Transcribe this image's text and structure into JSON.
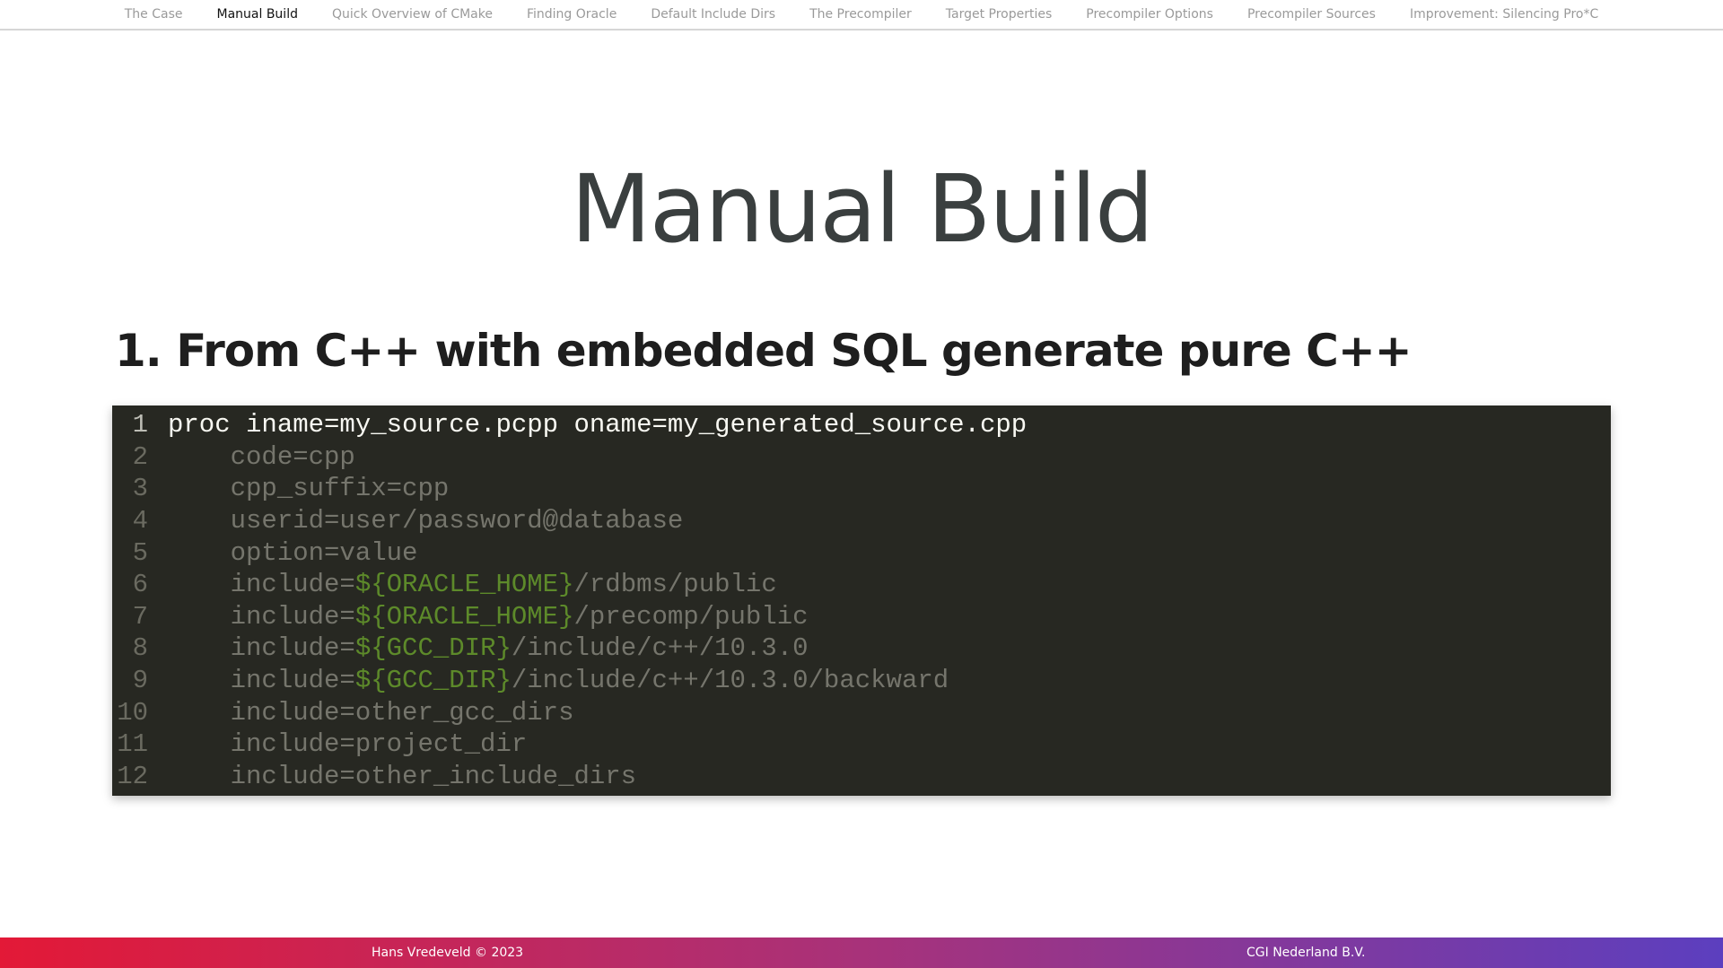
{
  "nav": {
    "items": [
      {
        "label": "The Case",
        "active": false
      },
      {
        "label": "Manual Build",
        "active": true
      },
      {
        "label": "Quick Overview of CMake",
        "active": false
      },
      {
        "label": "Finding Oracle",
        "active": false
      },
      {
        "label": "Default Include Dirs",
        "active": false
      },
      {
        "label": "The Precompiler",
        "active": false
      },
      {
        "label": "Target Properties",
        "active": false
      },
      {
        "label": "Precompiler Options",
        "active": false
      },
      {
        "label": "Precompiler Sources",
        "active": false
      },
      {
        "label": "Improvement: Silencing Pro*C",
        "active": false
      }
    ]
  },
  "slide": {
    "title": "Manual Build",
    "subheading": "1. From C++ with embedded SQL generate pure C++"
  },
  "code": {
    "lines": [
      {
        "no": "1",
        "highlight": true,
        "parts": [
          {
            "t": "proc iname=my_source.pcpp oname=my_generated_source.cpp"
          }
        ]
      },
      {
        "no": "2",
        "highlight": false,
        "parts": [
          {
            "t": "    code=cpp"
          }
        ]
      },
      {
        "no": "3",
        "highlight": false,
        "parts": [
          {
            "t": "    cpp_suffix=cpp"
          }
        ]
      },
      {
        "no": "4",
        "highlight": false,
        "parts": [
          {
            "t": "    userid=user/password@database"
          }
        ]
      },
      {
        "no": "5",
        "highlight": false,
        "parts": [
          {
            "t": "    option=value"
          }
        ]
      },
      {
        "no": "6",
        "highlight": false,
        "parts": [
          {
            "t": "    include="
          },
          {
            "t": "${ORACLE_HOME}",
            "var": true
          },
          {
            "t": "/rdbms/public"
          }
        ]
      },
      {
        "no": "7",
        "highlight": false,
        "parts": [
          {
            "t": "    include="
          },
          {
            "t": "${ORACLE_HOME}",
            "var": true
          },
          {
            "t": "/precomp/public"
          }
        ]
      },
      {
        "no": "8",
        "highlight": false,
        "parts": [
          {
            "t": "    include="
          },
          {
            "t": "${GCC_DIR}",
            "var": true
          },
          {
            "t": "/include/c++/10.3.0"
          }
        ]
      },
      {
        "no": "9",
        "highlight": false,
        "parts": [
          {
            "t": "    include="
          },
          {
            "t": "${GCC_DIR}",
            "var": true
          },
          {
            "t": "/include/c++/10.3.0/backward"
          }
        ]
      },
      {
        "no": "10",
        "highlight": false,
        "parts": [
          {
            "t": "    include=other_gcc_dirs"
          }
        ]
      },
      {
        "no": "11",
        "highlight": false,
        "parts": [
          {
            "t": "    include=project_dir"
          }
        ]
      },
      {
        "no": "12",
        "highlight": false,
        "parts": [
          {
            "t": "    include=other_include_dirs"
          }
        ]
      }
    ]
  },
  "footer": {
    "left": "Hans Vredeveld © 2023",
    "right": "CGI Nederland B.V."
  },
  "colors": {
    "code_bg": "#272822",
    "code_var": "#5d8a2a",
    "footer_gradient_start": "#e31937",
    "footer_gradient_end": "#5c3fbf"
  }
}
